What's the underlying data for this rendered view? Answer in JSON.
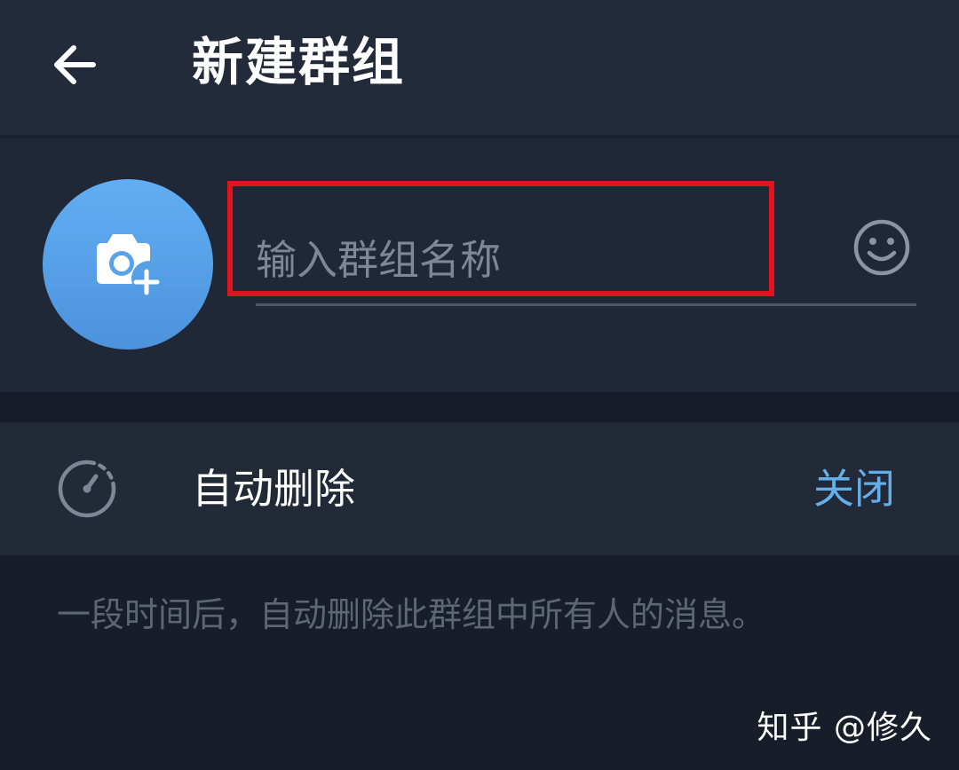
{
  "header": {
    "title": "新建群组",
    "back_icon": "arrow-left-icon"
  },
  "group": {
    "avatar_icon": "camera-add-icon",
    "avatar_color": "#58a2eb",
    "name_value": "",
    "name_placeholder": "输入群组名称",
    "emoji_icon": "smile-icon",
    "highlight_color": "#e0141e"
  },
  "auto_delete": {
    "icon": "timer-icon",
    "label": "自动删除",
    "value": "关闭",
    "value_color": "#64aeea"
  },
  "hint": "一段时间后，自动删除此群组中所有人的消息。",
  "watermark": "知乎 @修久"
}
